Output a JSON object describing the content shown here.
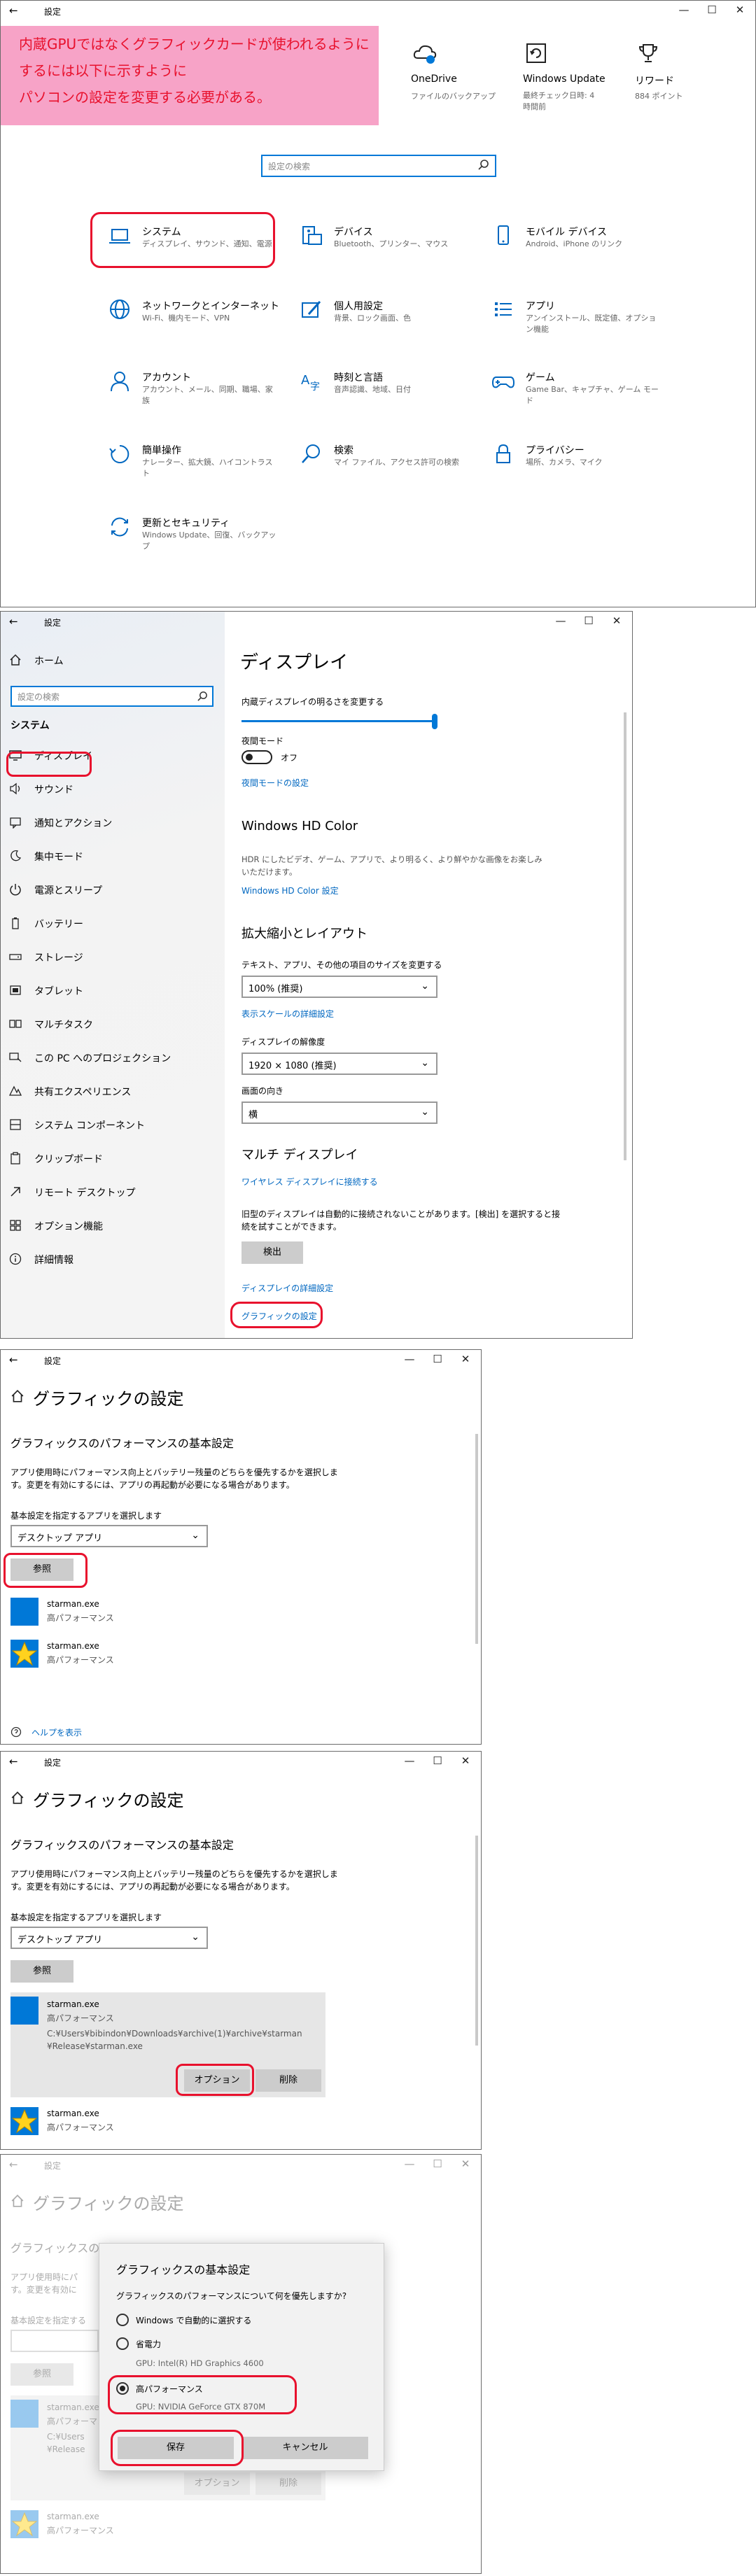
{
  "colors": {
    "accent": "#0067c0",
    "highlight": "#e8112d",
    "note_bg": "#f7a3c7",
    "note_text": "#e8112d",
    "tile_blue": "#0078d7"
  },
  "win1": {
    "title": "設定",
    "note": [
      "内蔵GPUではなくグラフィックカードが使われるように",
      "するには以下に示すように",
      "パソコンの設定を変更する必要がある。"
    ],
    "top_items": [
      {
        "name": "OneDrive",
        "sub": "ファイルのバックアップ"
      },
      {
        "name": "Windows Update",
        "sub": "最終チェック日時: 4 時間前"
      },
      {
        "name": "リワード",
        "sub": "884 ポイント"
      }
    ],
    "search_placeholder": "設定の検索",
    "categories": [
      {
        "name": "システム",
        "desc": "ディスプレイ、サウンド、通知、電源"
      },
      {
        "name": "デバイス",
        "desc": "Bluetooth、プリンター、マウス"
      },
      {
        "name": "モバイル デバイス",
        "desc": "Android、iPhone のリンク"
      },
      {
        "name": "ネットワークとインターネット",
        "desc": "Wi-Fi、機内モード、VPN"
      },
      {
        "name": "個人用設定",
        "desc": "背景、ロック画面、色"
      },
      {
        "name": "アプリ",
        "desc": "アンインストール、既定値、オプション機能"
      },
      {
        "name": "アカウント",
        "desc": "アカウント、メール、同期、職場、家族"
      },
      {
        "name": "時刻と言語",
        "desc": "音声認識、地域、日付"
      },
      {
        "name": "ゲーム",
        "desc": "Game Bar、キャプチャ、ゲーム モード"
      },
      {
        "name": "簡単操作",
        "desc": "ナレーター、拡大鏡、ハイコントラスト"
      },
      {
        "name": "検索",
        "desc": "マイ ファイル、アクセス許可の検索"
      },
      {
        "name": "プライバシー",
        "desc": "場所、カメラ、マイク"
      },
      {
        "name": "更新とセキュリティ",
        "desc": "Windows Update、回復、バックアップ"
      }
    ]
  },
  "win2": {
    "title": "設定",
    "home": "ホーム",
    "search_placeholder": "設定の検索",
    "section": "システム",
    "nav": [
      "ディスプレイ",
      "サウンド",
      "通知とアクション",
      "集中モード",
      "電源とスリープ",
      "バッテリー",
      "ストレージ",
      "タブレット",
      "マルチタスク",
      "この PC へのプロジェクション",
      "共有エクスペリエンス",
      "システム コンポーネント",
      "クリップボード",
      "リモート デスクトップ",
      "オプション機能",
      "詳細情報"
    ],
    "heading": "ディスプレイ",
    "brightness_label": "内蔵ディスプレイの明るさを変更する",
    "brightness_level": 1.0,
    "night_label": "夜間モード",
    "night_state": "オフ",
    "night_link": "夜間モードの設定",
    "hdr_title": "Windows HD Color",
    "hdr_desc": [
      "HDR にしたビデオ、ゲーム、アプリで、より明るく、より鮮やかな画像をお楽しみ",
      "いただけます。"
    ],
    "hdr_link": "Windows HD Color 設定",
    "scale_title": "拡大縮小とレイアウト",
    "scale_label": "テキスト、アプリ、その他の項目のサイズを変更する",
    "scale_value": "100% (推奨)",
    "scale_link": "表示スケールの詳細設定",
    "res_label": "ディスプレイの解像度",
    "res_value": "1920 × 1080 (推奨)",
    "orient_label": "画面の向き",
    "orient_value": "横",
    "multi_title": "マルチ ディスプレイ",
    "wireless_link": "ワイヤレス ディスプレイに接続する",
    "multi_desc": [
      "旧型のディスプレイは自動的に接続されないことがあります。[検出] を選択すると接",
      "続を試すことができます。"
    ],
    "detect_btn": "検出",
    "adv_link": "ディスプレイの詳細設定",
    "graphics_link": "グラフィックの設定"
  },
  "win3": {
    "title": "設定",
    "heading": "グラフィックの設定",
    "sub": "グラフィックスのパフォーマンスの基本設定",
    "desc": [
      "アプリ使用時にパフォーマンス向上とバッテリー残量のどちらを優先するかを選択しま",
      "す。変更を有効にするには、アプリの再起動が必要になる場合があります。"
    ],
    "select_label": "基本設定を指定するアプリを選択します",
    "select_value": "デスクトップ アプリ",
    "browse_btn": "参照",
    "apps": [
      {
        "name": "starman.exe",
        "pref": "高パフォーマンス"
      },
      {
        "name": "starman.exe",
        "pref": "高パフォーマンス"
      }
    ],
    "help": "ヘルプを表示"
  },
  "win4": {
    "title": "設定",
    "heading": "グラフィックの設定",
    "sub": "グラフィックスのパフォーマンスの基本設定",
    "desc": [
      "アプリ使用時にパフォーマンス向上とバッテリー残量のどちらを優先するかを選択しま",
      "す。変更を有効にするには、アプリの再起動が必要になる場合があります。"
    ],
    "select_label": "基本設定を指定するアプリを選択します",
    "select_value": "デスクトップ アプリ",
    "browse_btn": "参照",
    "app_name": "starman.exe",
    "app_pref": "高パフォーマンス",
    "app_path": [
      "C:¥Users¥bibindon¥Downloads¥archive(1)¥archive¥starman",
      "¥Release¥starman.exe"
    ],
    "options_btn": "オプション",
    "remove_btn": "削除",
    "app2_name": "starman.exe",
    "app2_pref": "高パフォーマンス"
  },
  "win5": {
    "title": "設定",
    "heading": "グラフィックの設定",
    "bg_sub": "グラフィックスのパ",
    "bg_desc": [
      "アプリ使用時にパ",
      "す。変更を有効に"
    ],
    "bg_label": "基本設定を指定する",
    "bg_browse": "参照",
    "bg_app": "starman.exe",
    "bg_app_pref": "高パフォーマンス",
    "bg_path": [
      "C:¥Users",
      "¥Release"
    ],
    "bg_options": "オプション",
    "bg_remove": "削除",
    "bg_app2": "starman.exe",
    "bg_app2_pref": "高パフォーマンス",
    "dialog": {
      "title": "グラフィックスの基本設定",
      "question": "グラフィックスのパフォーマンスについて何を優先しますか?",
      "opt1": "Windows で自動的に選択する",
      "opt2": "省電力",
      "opt2_gpu": "GPU: Intel(R) HD Graphics 4600",
      "opt3": "高パフォーマンス",
      "opt3_gpu": "GPU: NVIDIA GeForce GTX 870M",
      "selected": 3,
      "save": "保存",
      "cancel": "キャンセル"
    }
  }
}
